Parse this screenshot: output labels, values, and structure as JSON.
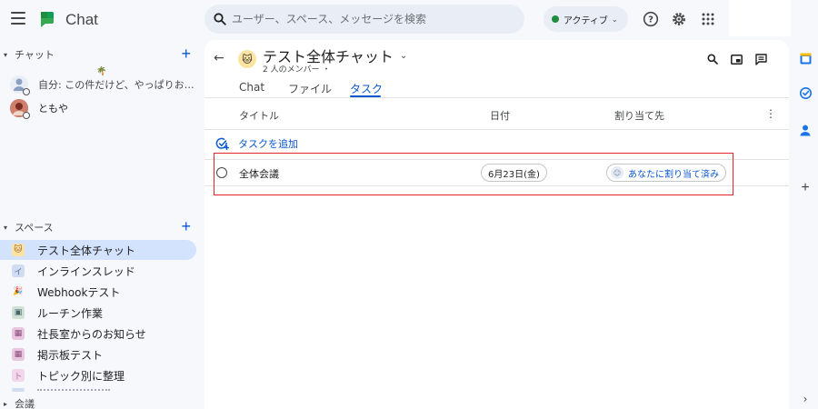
{
  "app": {
    "name": "Chat"
  },
  "search": {
    "placeholder": "ユーザー、スペース、メッセージを検索"
  },
  "status": {
    "label": "アクティブ"
  },
  "sidebar": {
    "chat_section": {
      "label": "チャット"
    },
    "direct_messages": [
      {
        "preview": "自分: この件だけど、やっぱりお願い..."
      },
      {
        "name": "ともや"
      }
    ],
    "spaces_section": {
      "label": "スペース"
    },
    "spaces": [
      {
        "label": "テスト全体チャット",
        "active": true,
        "color": "#fbe3a1"
      },
      {
        "label": "インラインスレッド",
        "color": "#d0dcf2"
      },
      {
        "label": "Webhookテスト",
        "color": "#f4c2c2"
      },
      {
        "label": "ルーチン作業",
        "color": "#cfe0d6"
      },
      {
        "label": "社長室からのお知らせ",
        "color": "#e9c6df"
      },
      {
        "label": "掲示板テスト",
        "color": "#e9c6df"
      },
      {
        "label": "トピック別に整理",
        "color": "#f1d6ec"
      }
    ],
    "meetings_section": {
      "label": "会議"
    }
  },
  "room": {
    "title": "テスト全体チャット",
    "subtitle": "2 人のメンバー ・",
    "tabs": [
      {
        "label": "Chat"
      },
      {
        "label": "ファイル"
      },
      {
        "label": "タスク",
        "active": true
      }
    ]
  },
  "tasks": {
    "columns": {
      "title": "タイトル",
      "date": "日付",
      "assignee": "割り当て先"
    },
    "add_label": "タスクを追加",
    "items": [
      {
        "title": "全体会議",
        "date": "6月23日(金)",
        "assignee": "あなたに割り当て済み"
      }
    ]
  },
  "colors": {
    "accent": "#0b57d0",
    "highlight": "#e4232a",
    "active_status": "#1e8e3e"
  }
}
